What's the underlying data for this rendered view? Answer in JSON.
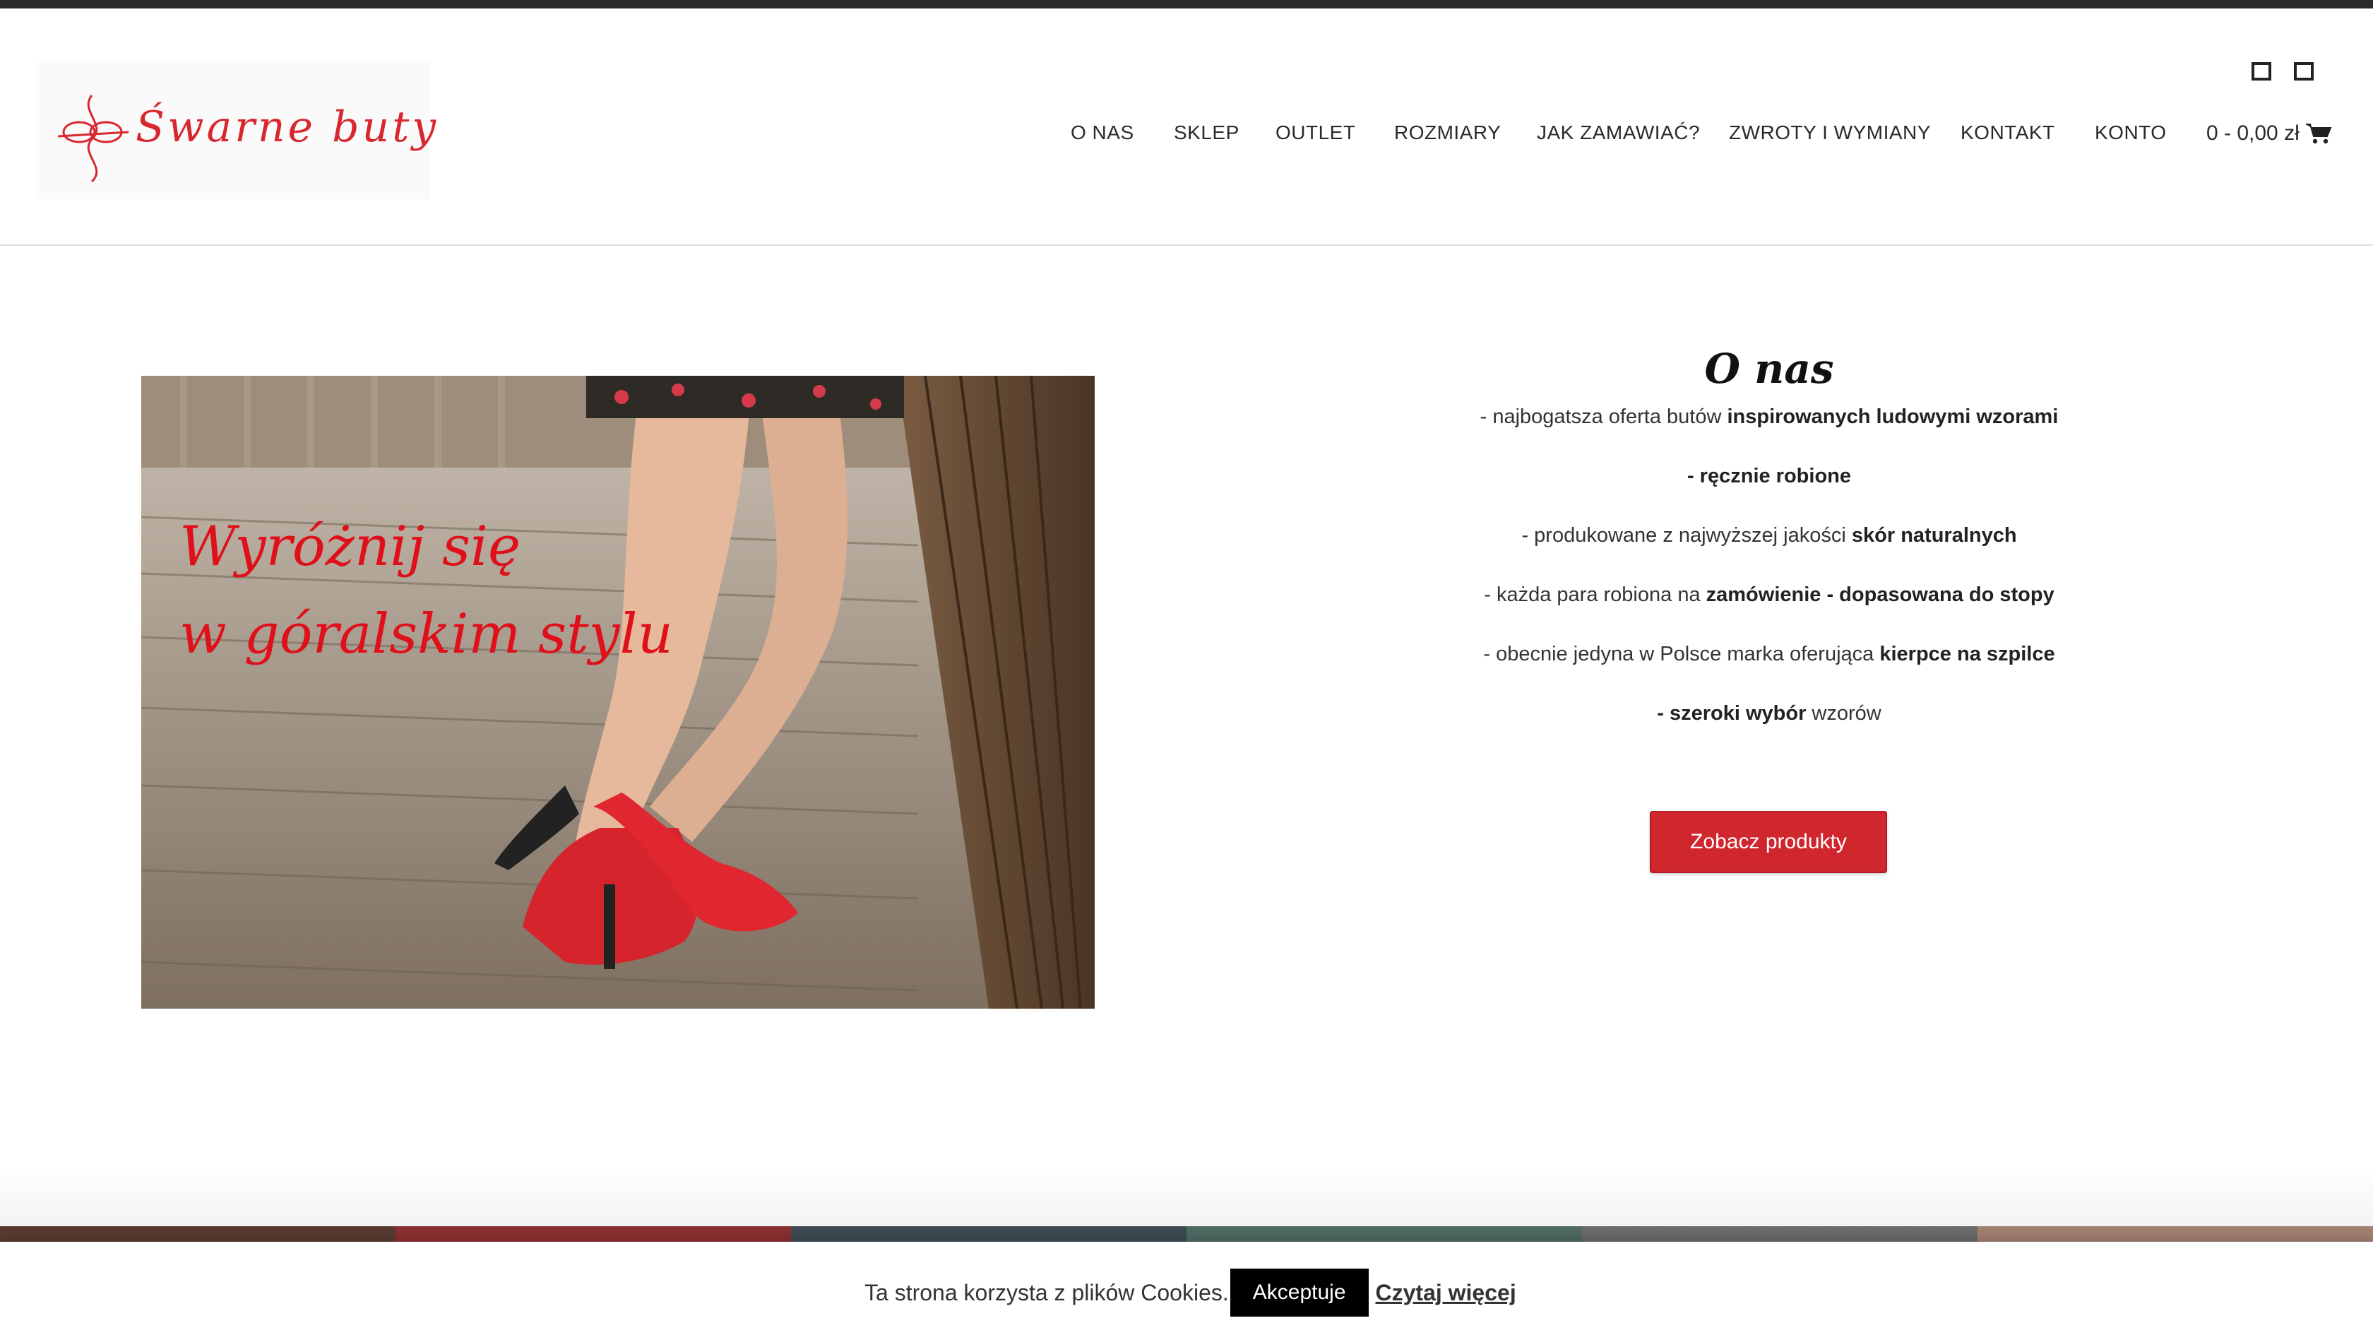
{
  "header": {
    "logo_text": "Śwarne buty",
    "nav": [
      {
        "label": "O NAS"
      },
      {
        "label": "SKLEP"
      },
      {
        "label": "OUTLET"
      },
      {
        "label": "ROZMIARY"
      },
      {
        "label": "JAK ZAMAWIAĆ?"
      },
      {
        "label": "ZWROTY I WYMIANY"
      },
      {
        "label": "KONTAKT"
      },
      {
        "label": "KONTO"
      }
    ],
    "cart_label": "0 - 0,00 zł",
    "cart_icon": "shopping-cart-icon"
  },
  "hero": {
    "caption_line1": "Wyróżnij się",
    "caption_line2": "w góralskim stylu"
  },
  "about": {
    "title": "O nas",
    "lines": [
      {
        "pre": "- najbogatsza oferta butów ",
        "bold": "inspirowanych ludowymi wzorami",
        "post": ""
      },
      {
        "pre": "",
        "bold": "- ręcznie robione",
        "post": ""
      },
      {
        "pre": "- produkowane z najwyższej jakości ",
        "bold": "skór naturalnych",
        "post": ""
      },
      {
        "pre": "- każda para robiona na ",
        "bold": "zamówienie - dopasowana do stopy",
        "post": ""
      },
      {
        "pre": "- obecnie jedyna w Polsce marka oferująca  ",
        "bold": "kierpce na szpilce",
        "post": ""
      },
      {
        "pre": "",
        "bold": "- szeroki wybór",
        "post": " wzorów"
      }
    ],
    "cta_label": "Zobacz produkty"
  },
  "cookie": {
    "text": "Ta strona korzysta z plików Cookies.",
    "accept_label": "Akceptuje",
    "more_label": "Czytaj więcej"
  },
  "colors": {
    "accent": "#d0262d",
    "topbar": "#2b2b2b"
  }
}
